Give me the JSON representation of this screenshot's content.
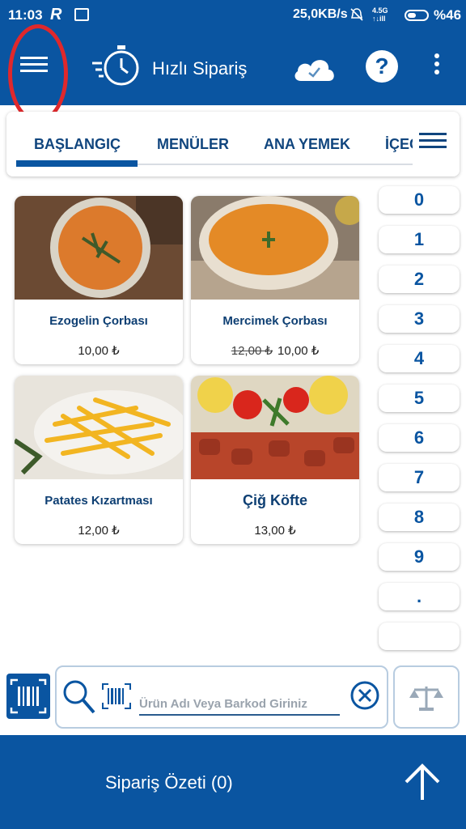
{
  "status_bar": {
    "time": "11:03",
    "network_speed": "25,0KB/s",
    "signal_label_top": "4.5G",
    "signal_label_bottom": "↑↓ill",
    "battery": "%46",
    "icons": [
      "r-icon",
      "store-icon",
      "bell-off-icon",
      "battery-icon"
    ]
  },
  "header": {
    "title": "Hızlı Sipariş",
    "icons": [
      "menu-icon",
      "stopwatch-icon",
      "cloud-check-icon",
      "help-icon",
      "more-vert-icon"
    ],
    "help_symbol": "?",
    "accent_color": "#0a55a1",
    "highlight_color": "#e0282c"
  },
  "tabs": {
    "items": [
      {
        "label": "BAŞLANGIÇ",
        "active": true
      },
      {
        "label": "MENÜLER",
        "active": false
      },
      {
        "label": "ANA YEMEK",
        "active": false
      },
      {
        "label": "İÇEC",
        "active": false
      }
    ]
  },
  "products": [
    {
      "name": "Ezogelin Çorbası",
      "price": "10,00 ₺",
      "old_price": ""
    },
    {
      "name": "Mercimek Çorbası",
      "price": "10,00 ₺",
      "old_price": "12,00 ₺"
    },
    {
      "name": "Patates Kızartması",
      "price": "12,00 ₺",
      "old_price": ""
    },
    {
      "name": "Çiğ Köfte",
      "price": "13,00 ₺",
      "old_price": ""
    }
  ],
  "keypad": {
    "keys": [
      "0",
      "1",
      "2",
      "3",
      "4",
      "5",
      "6",
      "7",
      "8",
      "9",
      ".",
      ""
    ]
  },
  "search": {
    "placeholder": "Ürün Adı Veya Barkod Giriniz",
    "value": "",
    "icons": [
      "barcode-scan-icon",
      "search-icon",
      "barcode-icon",
      "clear-icon",
      "scale-icon"
    ]
  },
  "footer": {
    "order_summary": "Sipariş Özeti (0)",
    "icon": "up-arrow-icon"
  }
}
